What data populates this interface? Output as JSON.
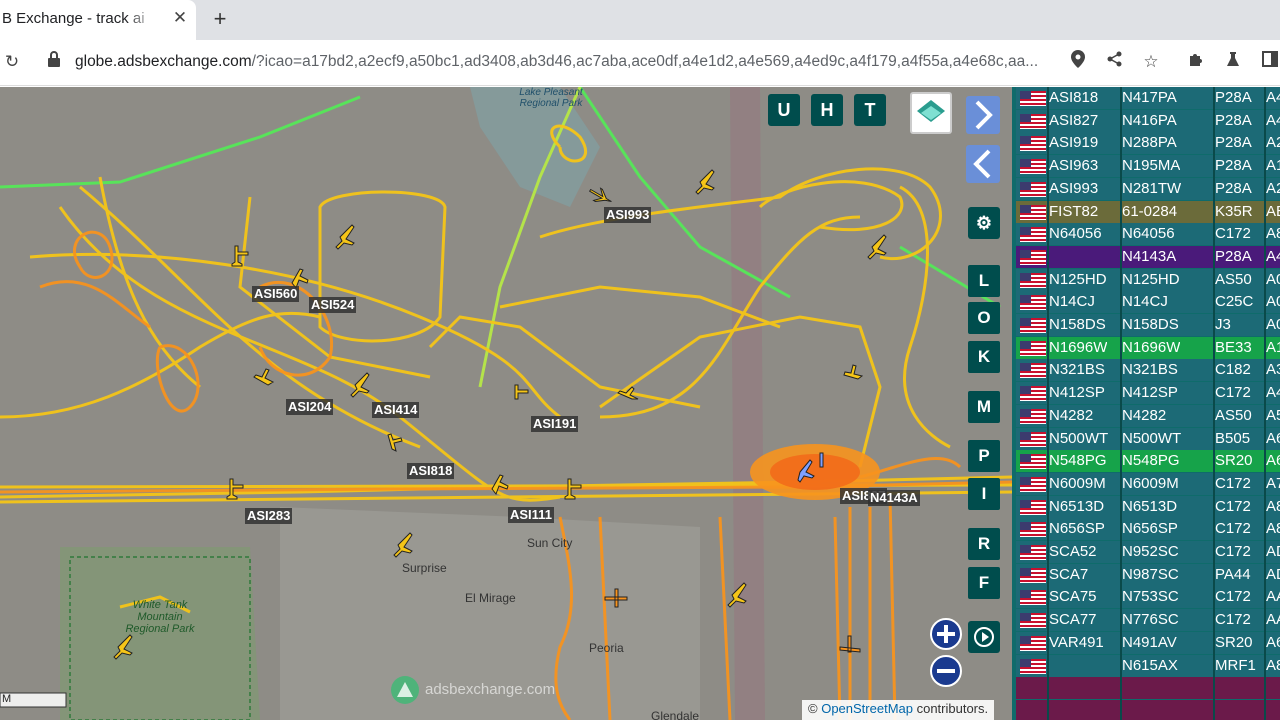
{
  "browser": {
    "tab_title": "B Exchange - track ai",
    "tab_close": "✕",
    "new_tab": "+",
    "url_host": "globe.adsbexchange.com",
    "url_path": "/?icao=a17bd2,a2ecf9,a50bc1,ad3408,ab3d46,ac7aba,ace0df,a4e1d2,a4e569,a4ed9c,a4f179,a4f55a,a4e68c,aa..."
  },
  "map": {
    "top_buttons": [
      "U",
      "H",
      "T"
    ],
    "side_buttons": [
      "L",
      "O",
      "K",
      "M",
      "P",
      "I",
      "R",
      "F"
    ],
    "places": [
      "Surprise",
      "Sun City",
      "El Mirage",
      "Peoria",
      "Glendale",
      "White Tank Mountain Regional Park",
      "Lake Pleasant Regional Park"
    ],
    "aircraft_labels": [
      "ASI993",
      "ASI560",
      "ASI524",
      "ASI204",
      "ASI414",
      "ASI191",
      "ASI818",
      "ASI283",
      "ASI111",
      "ASI827",
      "N4143A"
    ],
    "watermark": "adsbexchange.com",
    "attribution_prefix": "© ",
    "attribution_link": "OpenStreetMap",
    "attribution_suffix": " contributors.",
    "scale_label": "M"
  },
  "table": {
    "rows": [
      {
        "callsign": "ASI818",
        "reg": "N417PA",
        "type": "P28A",
        "hex": "A4",
        "style": "normal"
      },
      {
        "callsign": "ASI827",
        "reg": "N416PA",
        "type": "P28A",
        "hex": "A4",
        "style": "normal"
      },
      {
        "callsign": "ASI919",
        "reg": "N288PA",
        "type": "P28A",
        "hex": "A2",
        "style": "normal"
      },
      {
        "callsign": "ASI963",
        "reg": "N195MA",
        "type": "P28A",
        "hex": "A1",
        "style": "normal"
      },
      {
        "callsign": "ASI993",
        "reg": "N281TW",
        "type": "P28A",
        "hex": "A2",
        "style": "normal"
      },
      {
        "callsign": "FIST82",
        "reg": "61-0284",
        "type": "K35R",
        "hex": "AE",
        "style": "military"
      },
      {
        "callsign": "N64056",
        "reg": "N64056",
        "type": "C172",
        "hex": "A8",
        "style": "normal"
      },
      {
        "callsign": "",
        "reg": "N4143A",
        "type": "P28A",
        "hex": "A4",
        "style": "selected"
      },
      {
        "callsign": "N125HD",
        "reg": "N125HD",
        "type": "AS50",
        "hex": "A0",
        "style": "normal"
      },
      {
        "callsign": "N14CJ",
        "reg": "N14CJ",
        "type": "C25C",
        "hex": "A0",
        "style": "normal"
      },
      {
        "callsign": "N158DS",
        "reg": "N158DS",
        "type": "J3",
        "hex": "A0",
        "style": "normal"
      },
      {
        "callsign": "N1696W",
        "reg": "N1696W",
        "type": "BE33",
        "hex": "A1",
        "style": "green"
      },
      {
        "callsign": "N321BS",
        "reg": "N321BS",
        "type": "C182",
        "hex": "A3",
        "style": "normal"
      },
      {
        "callsign": "N412SP",
        "reg": "N412SP",
        "type": "C172",
        "hex": "A4",
        "style": "normal"
      },
      {
        "callsign": "N4282",
        "reg": "N4282",
        "type": "AS50",
        "hex": "A5",
        "style": "normal"
      },
      {
        "callsign": "N500WT",
        "reg": "N500WT",
        "type": "B505",
        "hex": "A6",
        "style": "normal"
      },
      {
        "callsign": "N548PG",
        "reg": "N548PG",
        "type": "SR20",
        "hex": "A6",
        "style": "green"
      },
      {
        "callsign": "N6009M",
        "reg": "N6009M",
        "type": "C172",
        "hex": "A7",
        "style": "normal"
      },
      {
        "callsign": "N6513D",
        "reg": "N6513D",
        "type": "C172",
        "hex": "A8",
        "style": "normal"
      },
      {
        "callsign": "N656SP",
        "reg": "N656SP",
        "type": "C172",
        "hex": "A8",
        "style": "normal"
      },
      {
        "callsign": "SCA52",
        "reg": "N952SC",
        "type": "C172",
        "hex": "AD",
        "style": "normal"
      },
      {
        "callsign": "SCA7",
        "reg": "N987SC",
        "type": "PA44",
        "hex": "AD",
        "style": "normal"
      },
      {
        "callsign": "SCA75",
        "reg": "N753SC",
        "type": "C172",
        "hex": "AA",
        "style": "normal"
      },
      {
        "callsign": "SCA77",
        "reg": "N776SC",
        "type": "C172",
        "hex": "AA",
        "style": "normal"
      },
      {
        "callsign": "VAR491",
        "reg": "N491AV",
        "type": "SR20",
        "hex": "A6",
        "style": "normal"
      },
      {
        "callsign": "",
        "reg": "N615AX",
        "type": "MRF1",
        "hex": "A8",
        "style": "normal"
      }
    ],
    "row_colors": {
      "normal": "#1c6a76",
      "military": "#6b6b3a",
      "selected": "#4a1a7a",
      "green": "#16a34a",
      "empty": "#6b1a4a"
    }
  }
}
